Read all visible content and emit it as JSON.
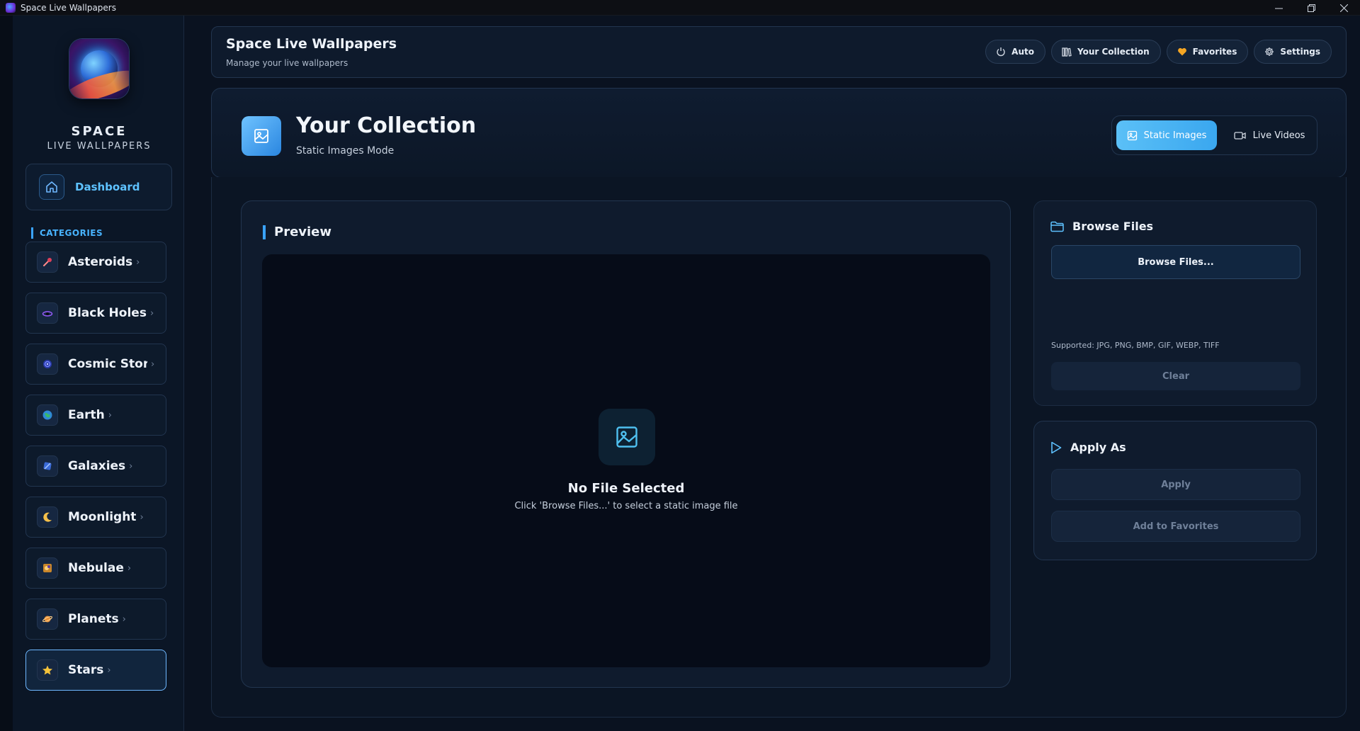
{
  "window": {
    "title": "Space Live Wallpapers",
    "minimize": "—",
    "restore": "❐",
    "close": "✕"
  },
  "sidebar": {
    "brand_title": "SPACE",
    "brand_subtitle": "LIVE WALLPAPERS",
    "dashboard_label": "Dashboard",
    "categories_label": "CATEGORIES",
    "items": [
      {
        "label": "Asteroids",
        "icon": "asteroid-icon"
      },
      {
        "label": "Black Holes",
        "icon": "black-hole-icon"
      },
      {
        "label": "Cosmic Storı",
        "icon": "cosmic-storm-icon"
      },
      {
        "label": "Earth",
        "icon": "earth-icon"
      },
      {
        "label": "Galaxies",
        "icon": "galaxy-icon"
      },
      {
        "label": "Moonlight",
        "icon": "moon-icon"
      },
      {
        "label": "Nebulae",
        "icon": "nebula-icon"
      },
      {
        "label": "Planets",
        "icon": "planet-icon"
      },
      {
        "label": "Stars",
        "icon": "star-icon",
        "active": true
      }
    ],
    "chevron": "›"
  },
  "header": {
    "title": "Space Live Wallpapers",
    "subtitle": "Manage your live wallpapers",
    "nav": {
      "auto": "Auto",
      "collection": "Your Collection",
      "favorites": "Favorites",
      "settings": "Settings"
    }
  },
  "collection": {
    "title": "Your Collection",
    "subtitle": "Static Images Mode",
    "mode_static": "Static Images",
    "mode_live": "Live Videos"
  },
  "preview": {
    "heading": "Preview",
    "empty_title": "No File Selected",
    "empty_subtitle": "Click 'Browse Files...' to select a static image file"
  },
  "browse": {
    "heading": "Browse Files",
    "button": "Browse Files...",
    "supported": "Supported: JPG, PNG, BMP, GIF, WEBP, TIFF",
    "clear": "Clear"
  },
  "apply": {
    "heading": "Apply As",
    "apply_button": "Apply",
    "favorites_button": "Add to Favorites"
  },
  "colors": {
    "accent": "#3aa3ff",
    "accent_light": "#5ec2ff",
    "background": "#0a1220",
    "panel": "#0f1b2d",
    "border": "#22354f",
    "favorite": "#f5a623"
  }
}
